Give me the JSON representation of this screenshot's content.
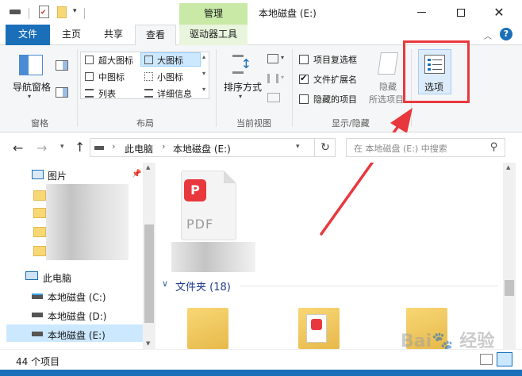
{
  "window": {
    "title": "本地磁盘 (E:)",
    "context_tab": "管理",
    "buttons": [
      "minimize",
      "maximize",
      "close"
    ]
  },
  "ribbon_tabs": [
    "文件",
    "主页",
    "共享",
    "查看",
    "驱动器工具"
  ],
  "ribbon": {
    "panes_group": {
      "label": "窗格",
      "nav_pane": "导航窗格"
    },
    "layout_group": {
      "label": "布局",
      "items": [
        "超大图标",
        "大图标",
        "中图标",
        "小图标",
        "列表",
        "详细信息"
      ],
      "selected": "大图标"
    },
    "current_view_group": {
      "label": "当前视图",
      "sort": "排序方式"
    },
    "show_hide_group": {
      "label": "显示/隐藏",
      "checkboxes": [
        {
          "label": "项目复选框",
          "checked": false
        },
        {
          "label": "文件扩展名",
          "checked": true
        },
        {
          "label": "隐藏的项目",
          "checked": false
        }
      ],
      "hide_selected": [
        "隐藏",
        "所选项目"
      ]
    },
    "options_button": "选项"
  },
  "address": {
    "path": [
      "此电脑",
      "本地磁盘 (E:)"
    ],
    "search_placeholder": "在 本地磁盘 (E:) 中搜索"
  },
  "nav_pane": {
    "pictures": "图片",
    "this_pc": "此电脑",
    "drives": [
      "本地磁盘 (C:)",
      "本地磁盘 (D:)",
      "本地磁盘 (E:)"
    ],
    "selected": "本地磁盘 (E:)"
  },
  "content": {
    "pdf_label": "PDF",
    "group_header": "文件夹 (18)"
  },
  "status": {
    "item_count": "44 个项目"
  },
  "annotation_color": "#e8383d",
  "accent_color": "#1a6fb8"
}
